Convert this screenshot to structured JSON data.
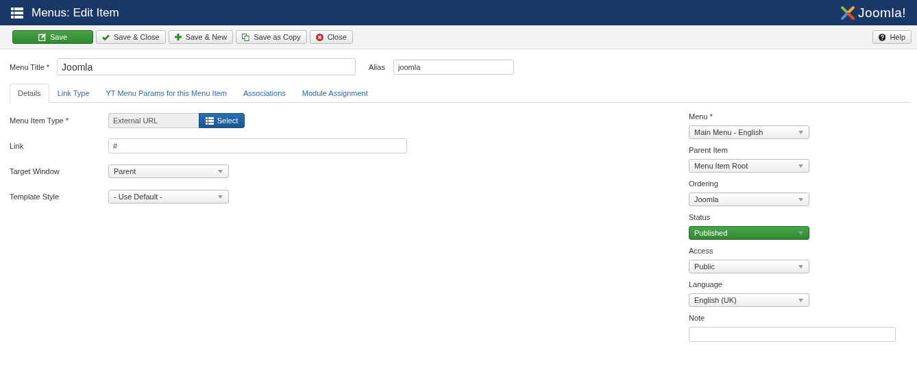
{
  "header": {
    "title": "Menus: Edit Item",
    "logo_text": "Joomla!"
  },
  "toolbar": {
    "buttons": [
      {
        "label": "Save",
        "kind": "primary"
      },
      {
        "label": "Save & Close",
        "kind": "default"
      },
      {
        "label": "Save & New",
        "kind": "default"
      },
      {
        "label": "Save as Copy",
        "kind": "default"
      },
      {
        "label": "Close",
        "kind": "default"
      }
    ],
    "help": "Help"
  },
  "title_row": {
    "menu_title_label": "Menu Title *",
    "menu_title_value": "Joomla",
    "alias_label": "Alias",
    "alias_value": "joomla"
  },
  "tabs": [
    {
      "label": "Details",
      "selected": true
    },
    {
      "label": "Link Type",
      "selected": false
    },
    {
      "label": "YT Menu Params for this Menu Item",
      "selected": false
    },
    {
      "label": "Associations",
      "selected": false
    },
    {
      "label": "Module Assignment",
      "selected": false
    }
  ],
  "details": [
    {
      "label": "Menu Item Type *",
      "kind": "type",
      "value": "External URL",
      "button": "Select"
    },
    {
      "label": "Link",
      "kind": "text",
      "value": "#"
    },
    {
      "label": "Target Window",
      "kind": "select",
      "value": "Parent"
    },
    {
      "label": "Template Style",
      "kind": "select",
      "value": "- Use Default -"
    }
  ],
  "sidebar": [
    {
      "label": "Menu *",
      "kind": "select",
      "value": "Main Menu - English"
    },
    {
      "label": "Parent Item",
      "kind": "select",
      "value": "Menu Item Root"
    },
    {
      "label": "Ordering",
      "kind": "select",
      "value": "Joomla"
    },
    {
      "label": "Status",
      "kind": "status",
      "value": "Published"
    },
    {
      "label": "Access",
      "kind": "select",
      "value": "Public"
    },
    {
      "label": "Language",
      "kind": "select",
      "value": "English (UK)"
    },
    {
      "label": "Note",
      "kind": "text"
    }
  ]
}
